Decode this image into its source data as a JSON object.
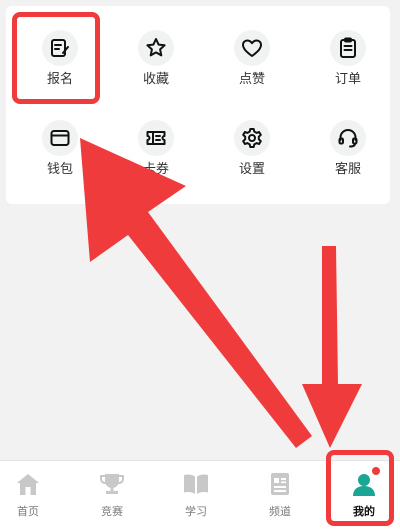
{
  "grid": {
    "items": [
      {
        "label": "报名",
        "icon": "signup-icon"
      },
      {
        "label": "收藏",
        "icon": "star-icon"
      },
      {
        "label": "点赞",
        "icon": "heart-icon"
      },
      {
        "label": "订单",
        "icon": "clipboard-icon"
      },
      {
        "label": "钱包",
        "icon": "wallet-icon"
      },
      {
        "label": "卡券",
        "icon": "ticket-icon"
      },
      {
        "label": "设置",
        "icon": "gear-icon"
      },
      {
        "label": "客服",
        "icon": "headset-icon"
      }
    ]
  },
  "tabbar": {
    "items": [
      {
        "label": "首页",
        "icon": "home-icon"
      },
      {
        "label": "竞赛",
        "icon": "trophy-icon"
      },
      {
        "label": "学习",
        "icon": "book-icon"
      },
      {
        "label": "频道",
        "icon": "channel-icon"
      },
      {
        "label": "我的",
        "icon": "user-icon",
        "active": true
      }
    ]
  },
  "colors": {
    "accent": "#1aa694",
    "highlight": "#ef3b3b",
    "icon_dark": "#111111",
    "tab_inactive": "#c8c8c8"
  }
}
